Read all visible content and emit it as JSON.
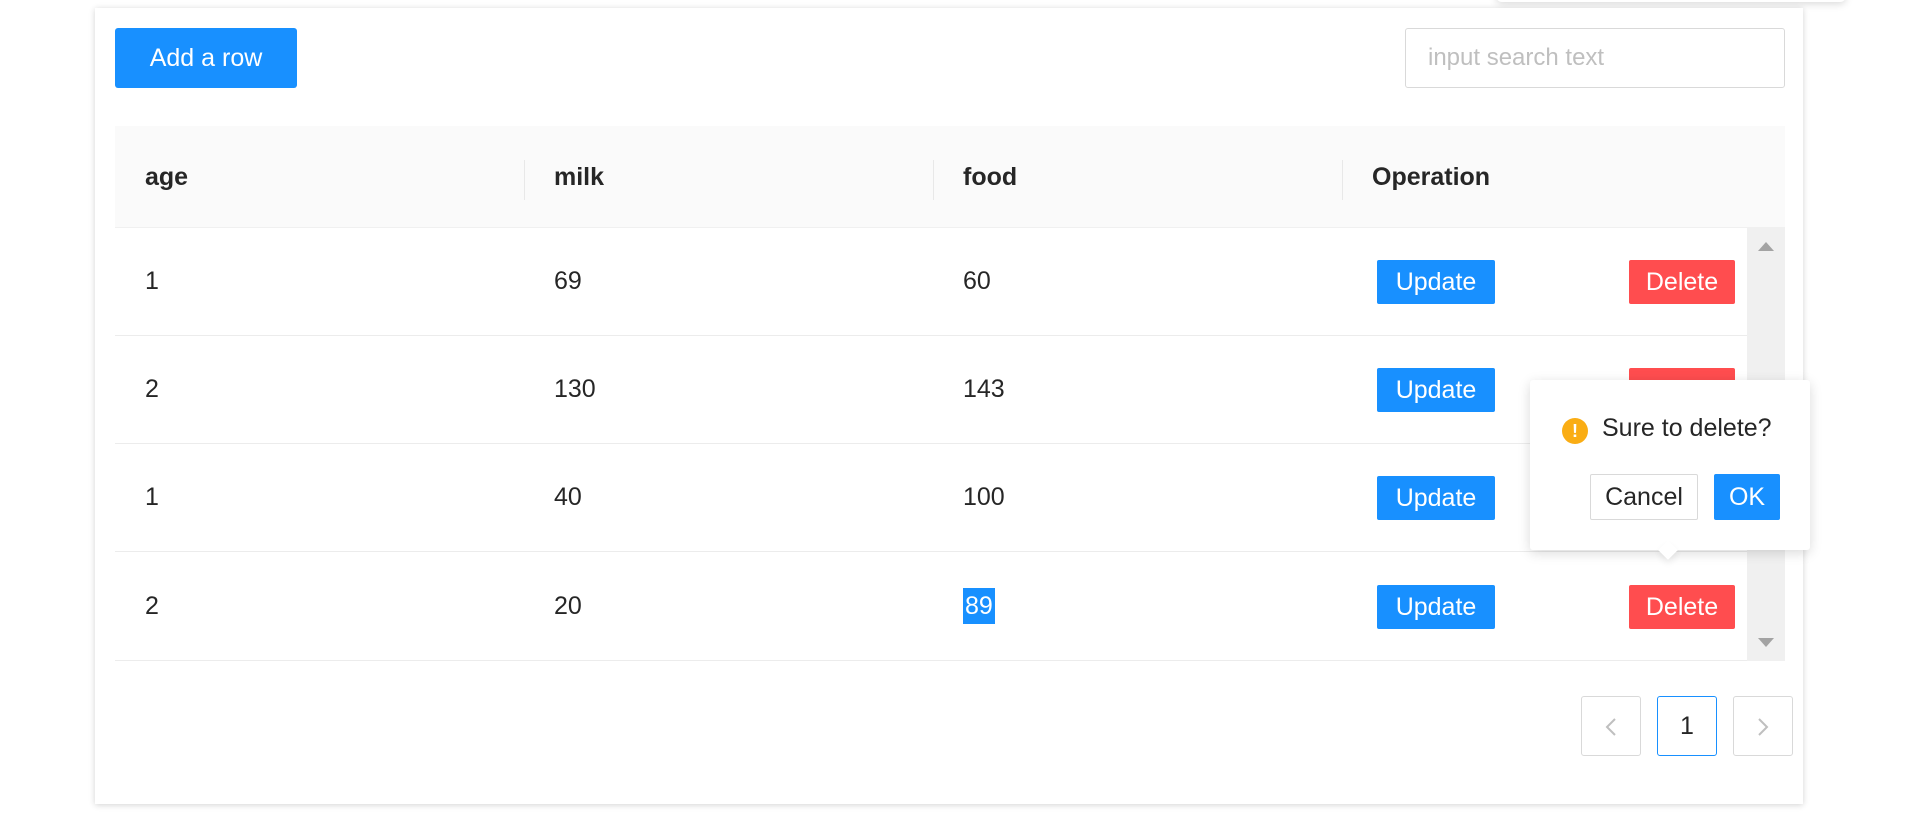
{
  "toolbar": {
    "add_label": "Add a row",
    "search_placeholder": "input search text",
    "search_value": ""
  },
  "table": {
    "columns": [
      "age",
      "milk",
      "food",
      "Operation"
    ],
    "rows": [
      {
        "age": "1",
        "milk": "69",
        "food": "60"
      },
      {
        "age": "2",
        "milk": "130",
        "food": "143"
      },
      {
        "age": "1",
        "milk": "40",
        "food": "100"
      },
      {
        "age": "2",
        "milk": "20",
        "food": "89"
      }
    ],
    "update_label": "Update",
    "delete_label": "Delete"
  },
  "pagination": {
    "prev_icon": "chevron-left-icon",
    "current_page": "1",
    "next_icon": "chevron-right-icon"
  },
  "popconfirm": {
    "icon": "exclamation-circle-icon",
    "icon_glyph": "!",
    "message": "Sure to delete?",
    "cancel_label": "Cancel",
    "ok_label": "OK"
  },
  "colors": {
    "primary": "#1890ff",
    "danger": "#ff4d4f",
    "warning": "#faad14"
  }
}
